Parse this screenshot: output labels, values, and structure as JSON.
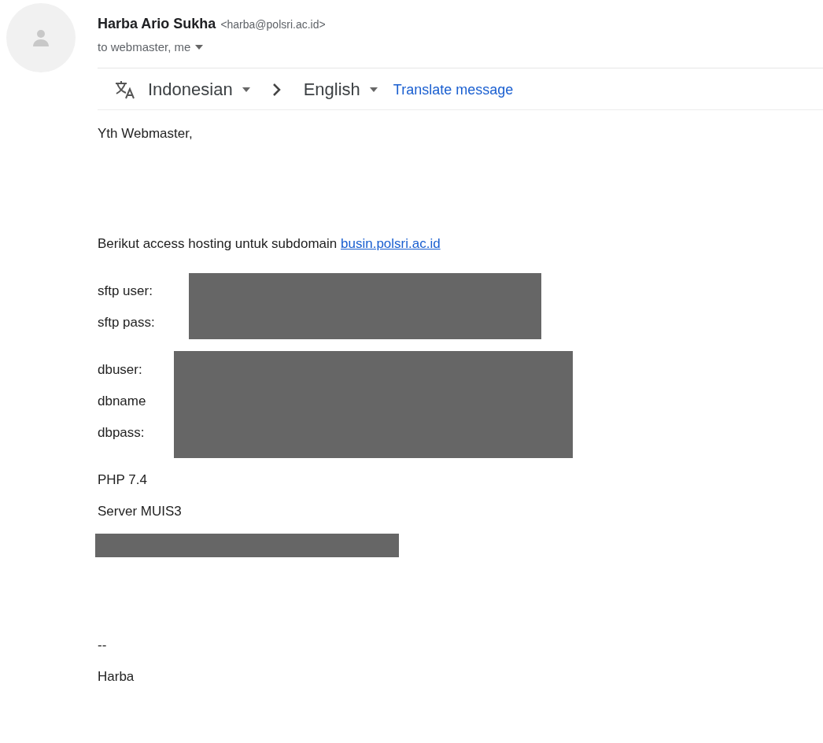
{
  "sender": {
    "name": "Harba Ario Sukha",
    "email": "<harba@polsri.ac.id>",
    "recipients": "to webmaster, me"
  },
  "translate_bar": {
    "from_language": "Indonesian",
    "to_language": "English",
    "action": "Translate message"
  },
  "body": [
    {
      "kind": "paragraph",
      "lines": [
        "Yth Webmaster,"
      ]
    },
    {
      "kind": "blank"
    },
    {
      "kind": "link_paragraph",
      "text": "Berikut access hosting untuk subdomain ",
      "link": "busin.polsri.ac.id"
    },
    {
      "kind": "redacted",
      "lines": [
        "sftp user:",
        "sftp pass:"
      ]
    },
    {
      "kind": "redacted",
      "lines": [
        "dbuser:",
        "dbname",
        "dbpass:"
      ]
    },
    {
      "kind": "paragraph",
      "lines": [
        "PHP 7.4",
        "Server MUIS3"
      ]
    },
    {
      "kind": "redaction"
    },
    {
      "kind": "blank"
    },
    {
      "kind": "paragraph",
      "lines": [
        "--",
        "Harba"
      ]
    }
  ]
}
